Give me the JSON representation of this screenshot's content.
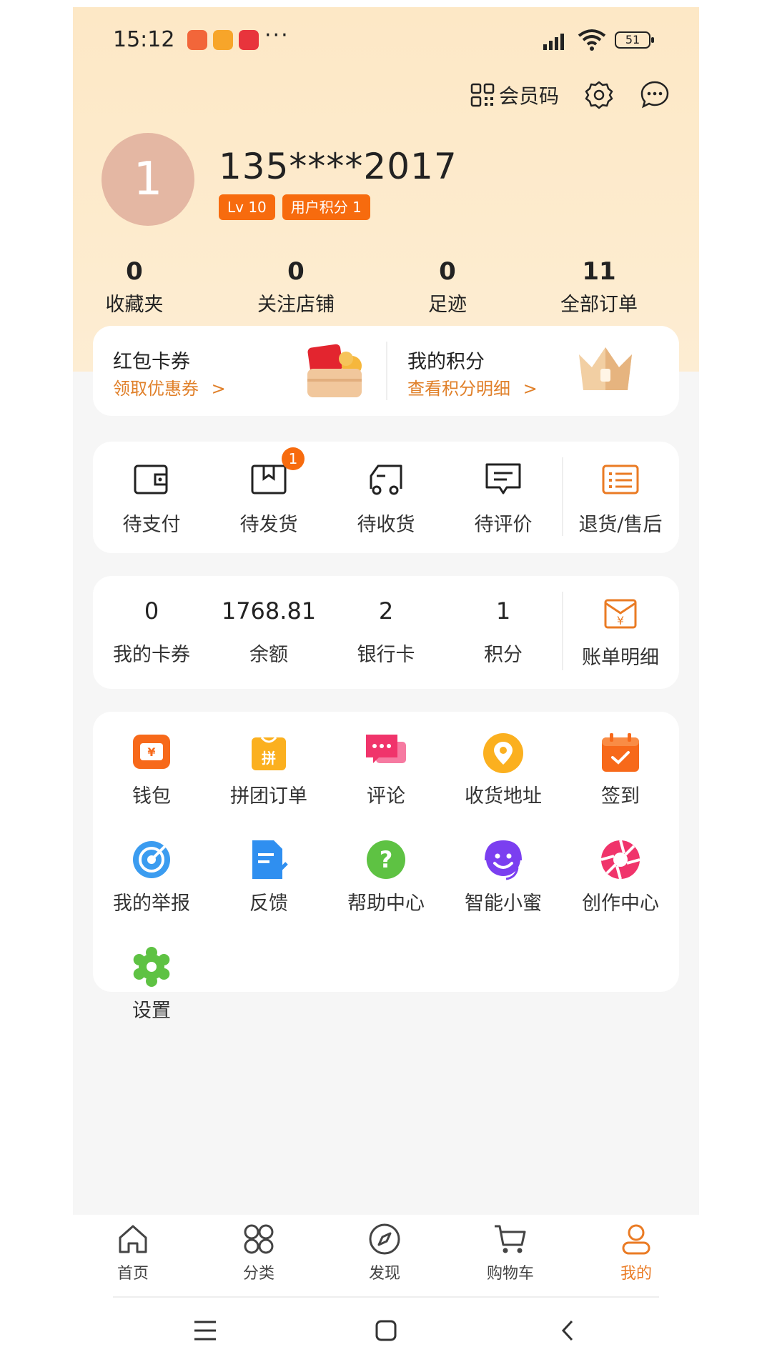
{
  "status_bar": {
    "time": "15:12",
    "battery": "51",
    "dots": "···"
  },
  "header": {
    "member_code_label": "会员码"
  },
  "profile": {
    "avatar_text": "1",
    "phone": "135****2017",
    "level_badge": "Lv 10",
    "points_badge": "用户积分 1"
  },
  "stats": [
    {
      "value": "0",
      "label": "收藏夹"
    },
    {
      "value": "0",
      "label": "关注店铺"
    },
    {
      "value": "0",
      "label": "足迹"
    },
    {
      "value": "11",
      "label": "全部订单"
    }
  ],
  "coupons": {
    "left_title": "红包卡券",
    "left_sub": "领取优惠券",
    "right_title": "我的积分",
    "right_sub": "查看积分明细",
    "chevron": ">"
  },
  "orders": {
    "items": [
      {
        "label": "待支付",
        "icon": "wallet-icon"
      },
      {
        "label": "待发货",
        "icon": "package-icon",
        "badge": "1"
      },
      {
        "label": "待收货",
        "icon": "truck-icon"
      },
      {
        "label": "待评价",
        "icon": "comment-icon"
      },
      {
        "label": "退货/售后",
        "icon": "list-icon"
      }
    ]
  },
  "assets": {
    "items": [
      {
        "value": "0",
        "label": "我的卡券"
      },
      {
        "value": "1768.81",
        "label": "余额"
      },
      {
        "value": "2",
        "label": "银行卡"
      },
      {
        "value": "1",
        "label": "积分"
      }
    ],
    "bill_label": "账单明细",
    "bill_icon_text": "¥"
  },
  "services": [
    {
      "label": "钱包",
      "icon": "wallet-icon",
      "color": "#f7691a"
    },
    {
      "label": "拼团订单",
      "icon": "group-order-icon",
      "color": "#fbb01f"
    },
    {
      "label": "评论",
      "icon": "chat-icon",
      "color": "#f0346b"
    },
    {
      "label": "收货地址",
      "icon": "location-icon",
      "color": "#fbb01f"
    },
    {
      "label": "签到",
      "icon": "calendar-check-icon",
      "color": "#f7691a"
    },
    {
      "label": "我的举报",
      "icon": "target-icon",
      "color": "#3b9cf0"
    },
    {
      "label": "反馈",
      "icon": "document-edit-icon",
      "color": "#2f8ff0"
    },
    {
      "label": "帮助中心",
      "icon": "help-icon",
      "color": "#5ec243"
    },
    {
      "label": "智能小蜜",
      "icon": "smiley-headset-icon",
      "color": "#7b3ff0"
    },
    {
      "label": "创作中心",
      "icon": "aperture-icon",
      "color": "#f0346b"
    },
    {
      "label": "设置",
      "icon": "gear-icon",
      "color": "#5ec243"
    }
  ],
  "service_glyphs": {
    "wallet": "¥",
    "group": "拼",
    "help": "?"
  },
  "bottom_nav": [
    {
      "label": "首页",
      "icon": "home-icon"
    },
    {
      "label": "分类",
      "icon": "category-icon"
    },
    {
      "label": "发现",
      "icon": "compass-icon"
    },
    {
      "label": "购物车",
      "icon": "cart-icon"
    },
    {
      "label": "我的",
      "icon": "user-icon",
      "active": true
    }
  ],
  "colors": {
    "accent": "#ea7b24",
    "badge": "#f76b0e",
    "header_bg": "#fde8c6"
  }
}
